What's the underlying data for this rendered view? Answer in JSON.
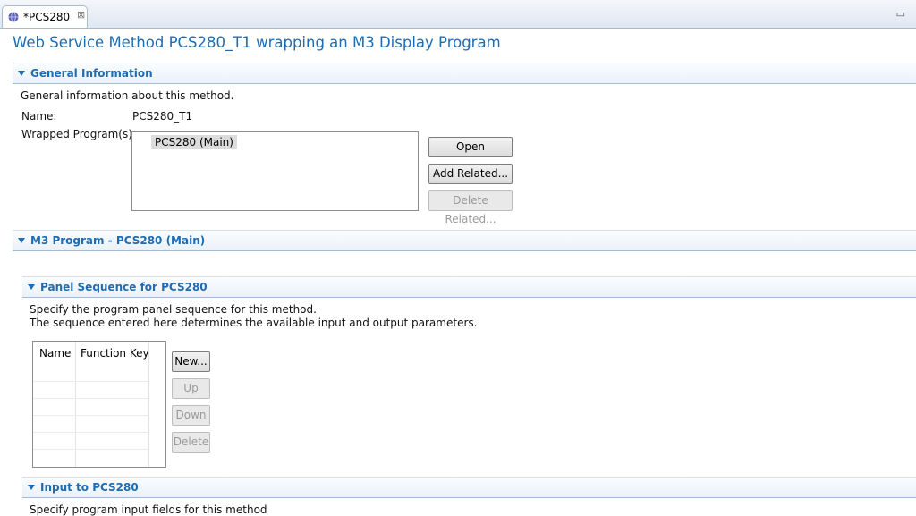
{
  "editor_tab": {
    "title": "*PCS280",
    "close_symbol": "⊠",
    "icon": "web-service-icon"
  },
  "view_menu_symbol": "▭",
  "page_title": "Web Service Method PCS280_T1 wrapping an M3 Display Program",
  "general": {
    "header": "General Information",
    "description": "General information about this method.",
    "name_label": "Name:",
    "name_value": "PCS280_T1",
    "wrapped_label": "Wrapped Program(s):",
    "wrapped_items": [
      "PCS280 (Main)"
    ],
    "open_button": "Open",
    "add_related_button": "Add Related...",
    "delete_related_button": "Delete Related..."
  },
  "m3_program": {
    "header": "M3 Program - PCS280 (Main)"
  },
  "panel_sequence": {
    "header": "Panel Sequence for PCS280",
    "description_line1": "Specify the program panel sequence for this method.",
    "description_line2": "The sequence entered here determines the available input and output parameters.",
    "columns": [
      "Name",
      "Function Key"
    ],
    "new_button": "New...",
    "up_button": "Up",
    "down_button": "Down",
    "delete_button": "Delete"
  },
  "input": {
    "header": "Input to PCS280",
    "description": "Specify program input fields for this method"
  },
  "colors": {
    "accent": "#1f6cb1",
    "header_border": "#9fbcd9",
    "disabled_text": "#9a9a9a"
  }
}
